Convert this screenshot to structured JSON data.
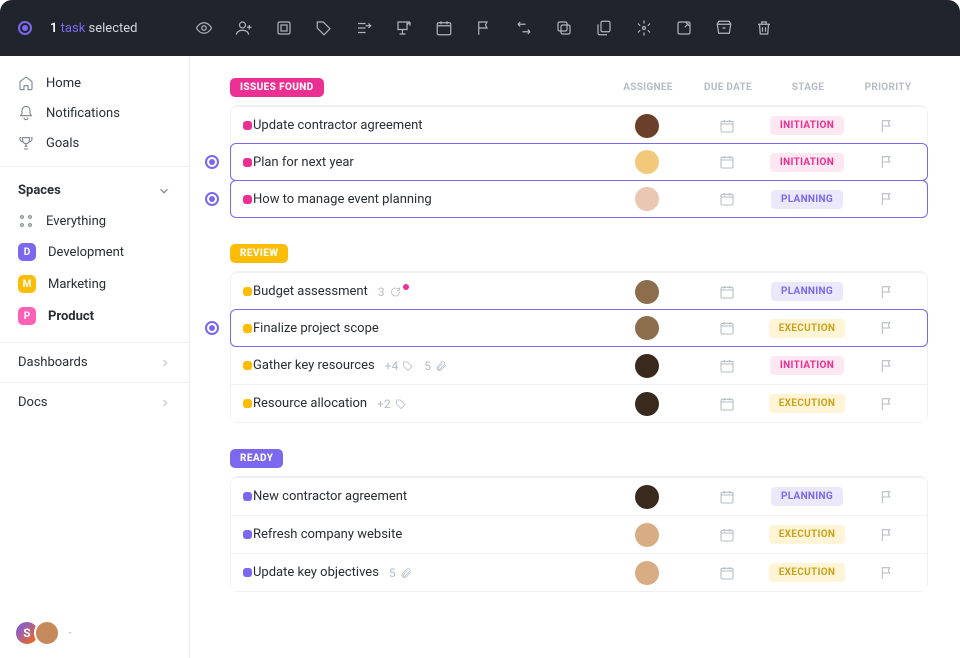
{
  "selectionBar": {
    "count": "1",
    "word": "task",
    "tail": "selected"
  },
  "nav": {
    "home": "Home",
    "notifications": "Notifications",
    "goals": "Goals",
    "spacesHeader": "Spaces",
    "everything": "Everything",
    "dashboards": "Dashboards",
    "docs": "Docs"
  },
  "spaces": [
    {
      "letter": "D",
      "name": "Development",
      "color": "#7b68ee"
    },
    {
      "letter": "M",
      "name": "Marketing",
      "color": "#fbbd08"
    },
    {
      "letter": "P",
      "name": "Product",
      "color": "#ff5fb4",
      "active": true
    }
  ],
  "columns": {
    "assignee": "ASSIGNEE",
    "due": "DUE DATE",
    "stage": "STAGE",
    "priority": "PRIORITY"
  },
  "groups": [
    {
      "name": "ISSUES FOUND",
      "pillColor": "#ec2f92",
      "color": "#ec2f92",
      "rows": [
        {
          "title": "Update contractor agreement",
          "stage": "INITIATION",
          "selected": false,
          "avatar": 1
        },
        {
          "title": "Plan for next year",
          "stage": "INITIATION",
          "selected": true,
          "avatar": 2
        },
        {
          "title": "How to manage event planning",
          "stage": "PLANNING",
          "selected": true,
          "avatar": 3
        }
      ]
    },
    {
      "name": "REVIEW",
      "pillColor": "#fbbd08",
      "color": "#fbbd08",
      "rows": [
        {
          "title": "Budget assessment",
          "stage": "PLANNING",
          "selected": false,
          "avatar": 4,
          "comments": "3",
          "commentDot": true
        },
        {
          "title": "Finalize project scope",
          "stage": "EXECUTION",
          "selected": true,
          "avatar": 4
        },
        {
          "title": "Gather key resources",
          "stage": "INITIATION",
          "selected": false,
          "avatar": 5,
          "tagCount": "+4",
          "attachCount": "5"
        },
        {
          "title": "Resource allocation",
          "stage": "EXECUTION",
          "selected": false,
          "avatar": 6,
          "tagCount": "+2"
        }
      ]
    },
    {
      "name": "READY",
      "pillColor": "#7b68ee",
      "color": "#7b68ee",
      "rows": [
        {
          "title": "New contractor agreement",
          "stage": "PLANNING",
          "selected": false,
          "avatar": 7
        },
        {
          "title": "Refresh company website",
          "stage": "EXECUTION",
          "selected": false,
          "avatar": 8
        },
        {
          "title": "Update key objectives",
          "stage": "EXECUTION",
          "selected": false,
          "avatar": 9,
          "attachCount": "5"
        }
      ]
    }
  ],
  "profile": {
    "initial": "S"
  },
  "toolbarIcons": [
    "watch-icon",
    "add-assignee-icon",
    "change-status-icon",
    "tags-icon",
    "move-icon",
    "set-parent-icon",
    "dates-icon",
    "priority-icon",
    "dependencies-icon",
    "duplicate-icon",
    "copy-icon",
    "merge-icon",
    "template-icon",
    "archive-icon",
    "trash-icon"
  ]
}
